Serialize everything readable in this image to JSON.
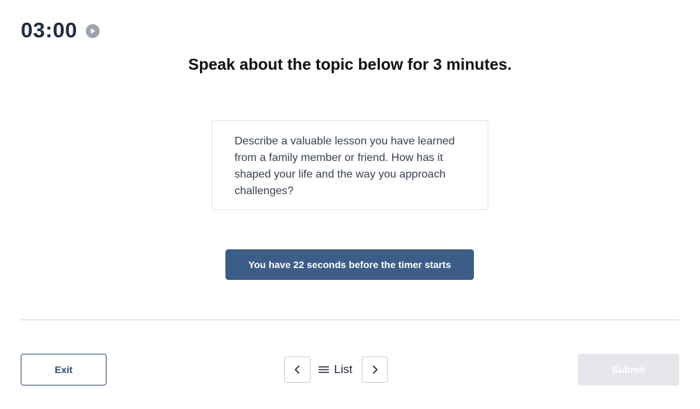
{
  "timer": {
    "time": "03:00",
    "play_icon": "play-circle-icon"
  },
  "main": {
    "heading": "Speak about the topic below for 3 minutes.",
    "prompt": "Describe a valuable lesson you have learned from a family member or friend. How has it shaped your life and the way you approach challenges?",
    "countdown_label": "You have 22 seconds before the timer starts"
  },
  "footer": {
    "exit_label": "Exit",
    "prev_icon": "chevron-left-icon",
    "list_icon": "menu-lines-icon",
    "list_label": "List",
    "next_icon": "chevron-right-icon",
    "submit_label": "Submit",
    "submit_disabled": true
  },
  "colors": {
    "primary": "#3d5d89",
    "timer_text": "#1f2d44",
    "submit_disabled_bg": "#e5e7eb",
    "divider": "#e5e7eb"
  }
}
